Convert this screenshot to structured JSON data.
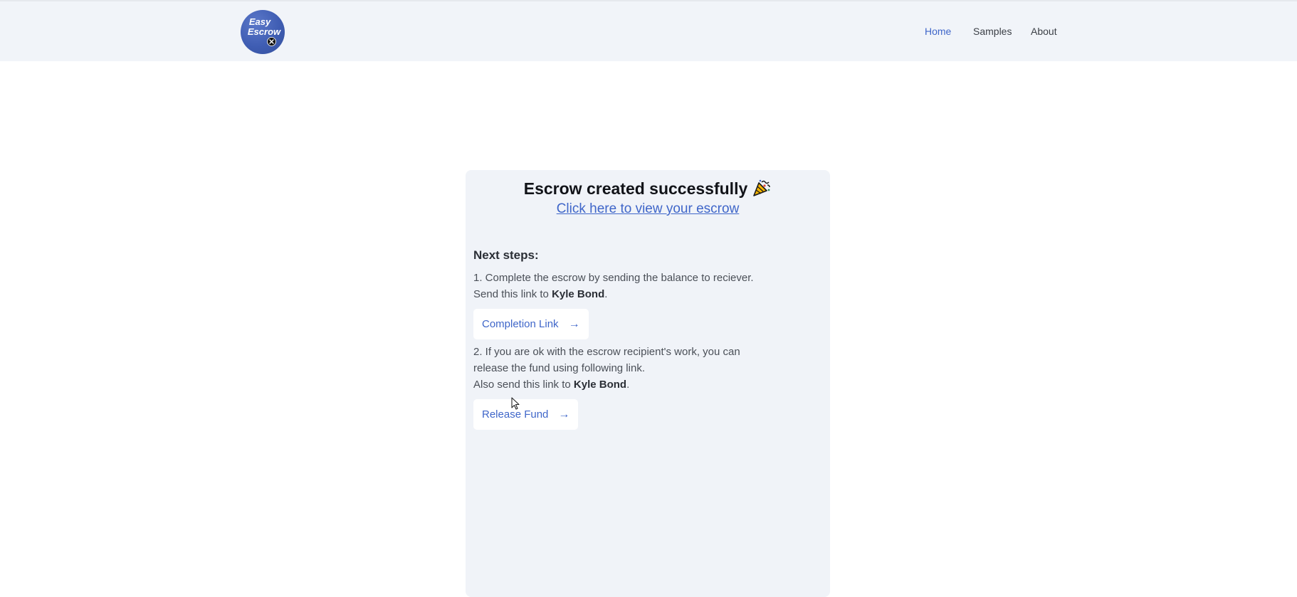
{
  "header": {
    "logo_line1": "Easy",
    "logo_line2": "Escrow",
    "nav": [
      {
        "label": "Home",
        "active": true
      },
      {
        "label": "Samples",
        "active": false
      },
      {
        "label": "About",
        "active": false
      }
    ]
  },
  "card": {
    "title": "Escrow created successfully",
    "title_icon": "party-popper-icon",
    "view_link": "Click here to view your escrow",
    "next_steps_heading": "Next steps:",
    "step1": {
      "line1": "1. Complete the escrow by sending the balance to reciever.",
      "line2_prefix": "Send this link to ",
      "recipient": "Kyle Bond",
      "line2_suffix": ".",
      "button_label": "Completion Link",
      "button_icon": "arrow-right-icon"
    },
    "step2": {
      "line1": "2. If you are ok with the escrow recipient's work, you can",
      "line2": "release the fund using following link.",
      "line3_prefix": "Also send this link to ",
      "recipient": "Kyle Bond",
      "line3_suffix": ".",
      "button_label": "Release Fund",
      "button_icon": "arrow-right-icon"
    }
  },
  "colors": {
    "accent": "#3f66c9",
    "header_bg": "#f1f4f9",
    "card_bg": "#f0f3f8",
    "logo_bg": "#3f5db3"
  }
}
